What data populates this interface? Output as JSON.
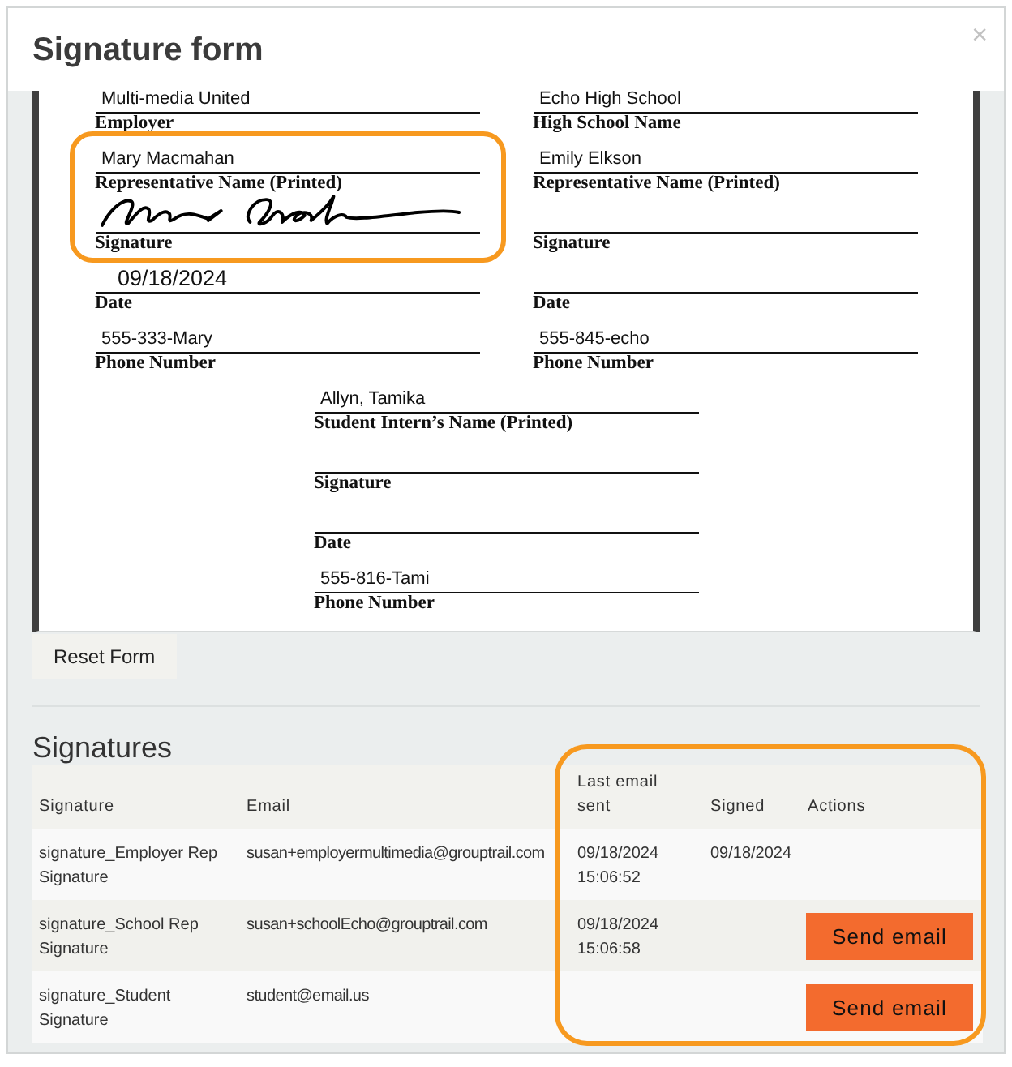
{
  "window": {
    "title": "Signature form",
    "close": "×"
  },
  "document": {
    "sections": [
      {
        "fields": [
          {
            "kind": "text",
            "value": "Multi-media United",
            "label": "Employer",
            "outlined": false
          },
          {
            "kind": "text",
            "value": "Mary Macmahan",
            "label": "Representative Name (Printed)",
            "outlined": true
          },
          {
            "kind": "signature",
            "signed": true,
            "label": "Signature",
            "outlined": true
          },
          {
            "kind": "date",
            "value": "09/18/2024",
            "label": "Date",
            "outlined": false
          },
          {
            "kind": "text",
            "value": "555-333-Mary",
            "label": "Phone Number",
            "outlined": false
          }
        ]
      },
      {
        "fields": [
          {
            "kind": "text",
            "value": "Echo High School",
            "label": "High School Name",
            "outlined": false
          },
          {
            "kind": "text",
            "value": "Emily Elkson",
            "label": "Representative Name (Printed)",
            "outlined": false
          },
          {
            "kind": "signature",
            "signed": false,
            "label": "Signature",
            "outlined": false
          },
          {
            "kind": "date",
            "label": "Date",
            "outlined": false
          },
          {
            "kind": "text",
            "value": "555-845-echo",
            "label": "Phone Number",
            "outlined": false
          }
        ]
      },
      {
        "fields": [
          {
            "kind": "text",
            "value": "Allyn, Tamika",
            "label": "Student Intern’s Name (Printed)",
            "outlined": false
          },
          {
            "kind": "signature",
            "signed": false,
            "label": "Signature",
            "outlined": false
          },
          {
            "kind": "date",
            "label": "Date",
            "outlined": false
          },
          {
            "kind": "text",
            "value": "555-816-Tami",
            "label": "Phone Number",
            "outlined": false
          }
        ]
      }
    ]
  },
  "reset_button": "Reset Form",
  "signatures": {
    "title": "Signatures",
    "columns": [
      {
        "label": "Signature",
        "outlined": false
      },
      {
        "label": "Email",
        "outlined": false
      },
      {
        "label": "Last email sent",
        "outlined": true
      },
      {
        "label": "Signed",
        "outlined": true
      },
      {
        "label": "Actions",
        "outlined": true
      }
    ],
    "rows": [
      {
        "signature": "signature_Employer Rep Signature",
        "email": "susan+employermultimedia@grouptrail.com",
        "last_email_sent": "09/18/2024 15:06:52",
        "signed": "09/18/2024"
      },
      {
        "signature": "signature_School Rep Signature",
        "email": "susan+schoolEcho@grouptrail.com",
        "last_email_sent": "09/18/2024 15:06:58",
        "action": "Send email"
      },
      {
        "signature": "signature_Student Signature",
        "email": "student@email.us",
        "action": "Send email"
      }
    ]
  }
}
